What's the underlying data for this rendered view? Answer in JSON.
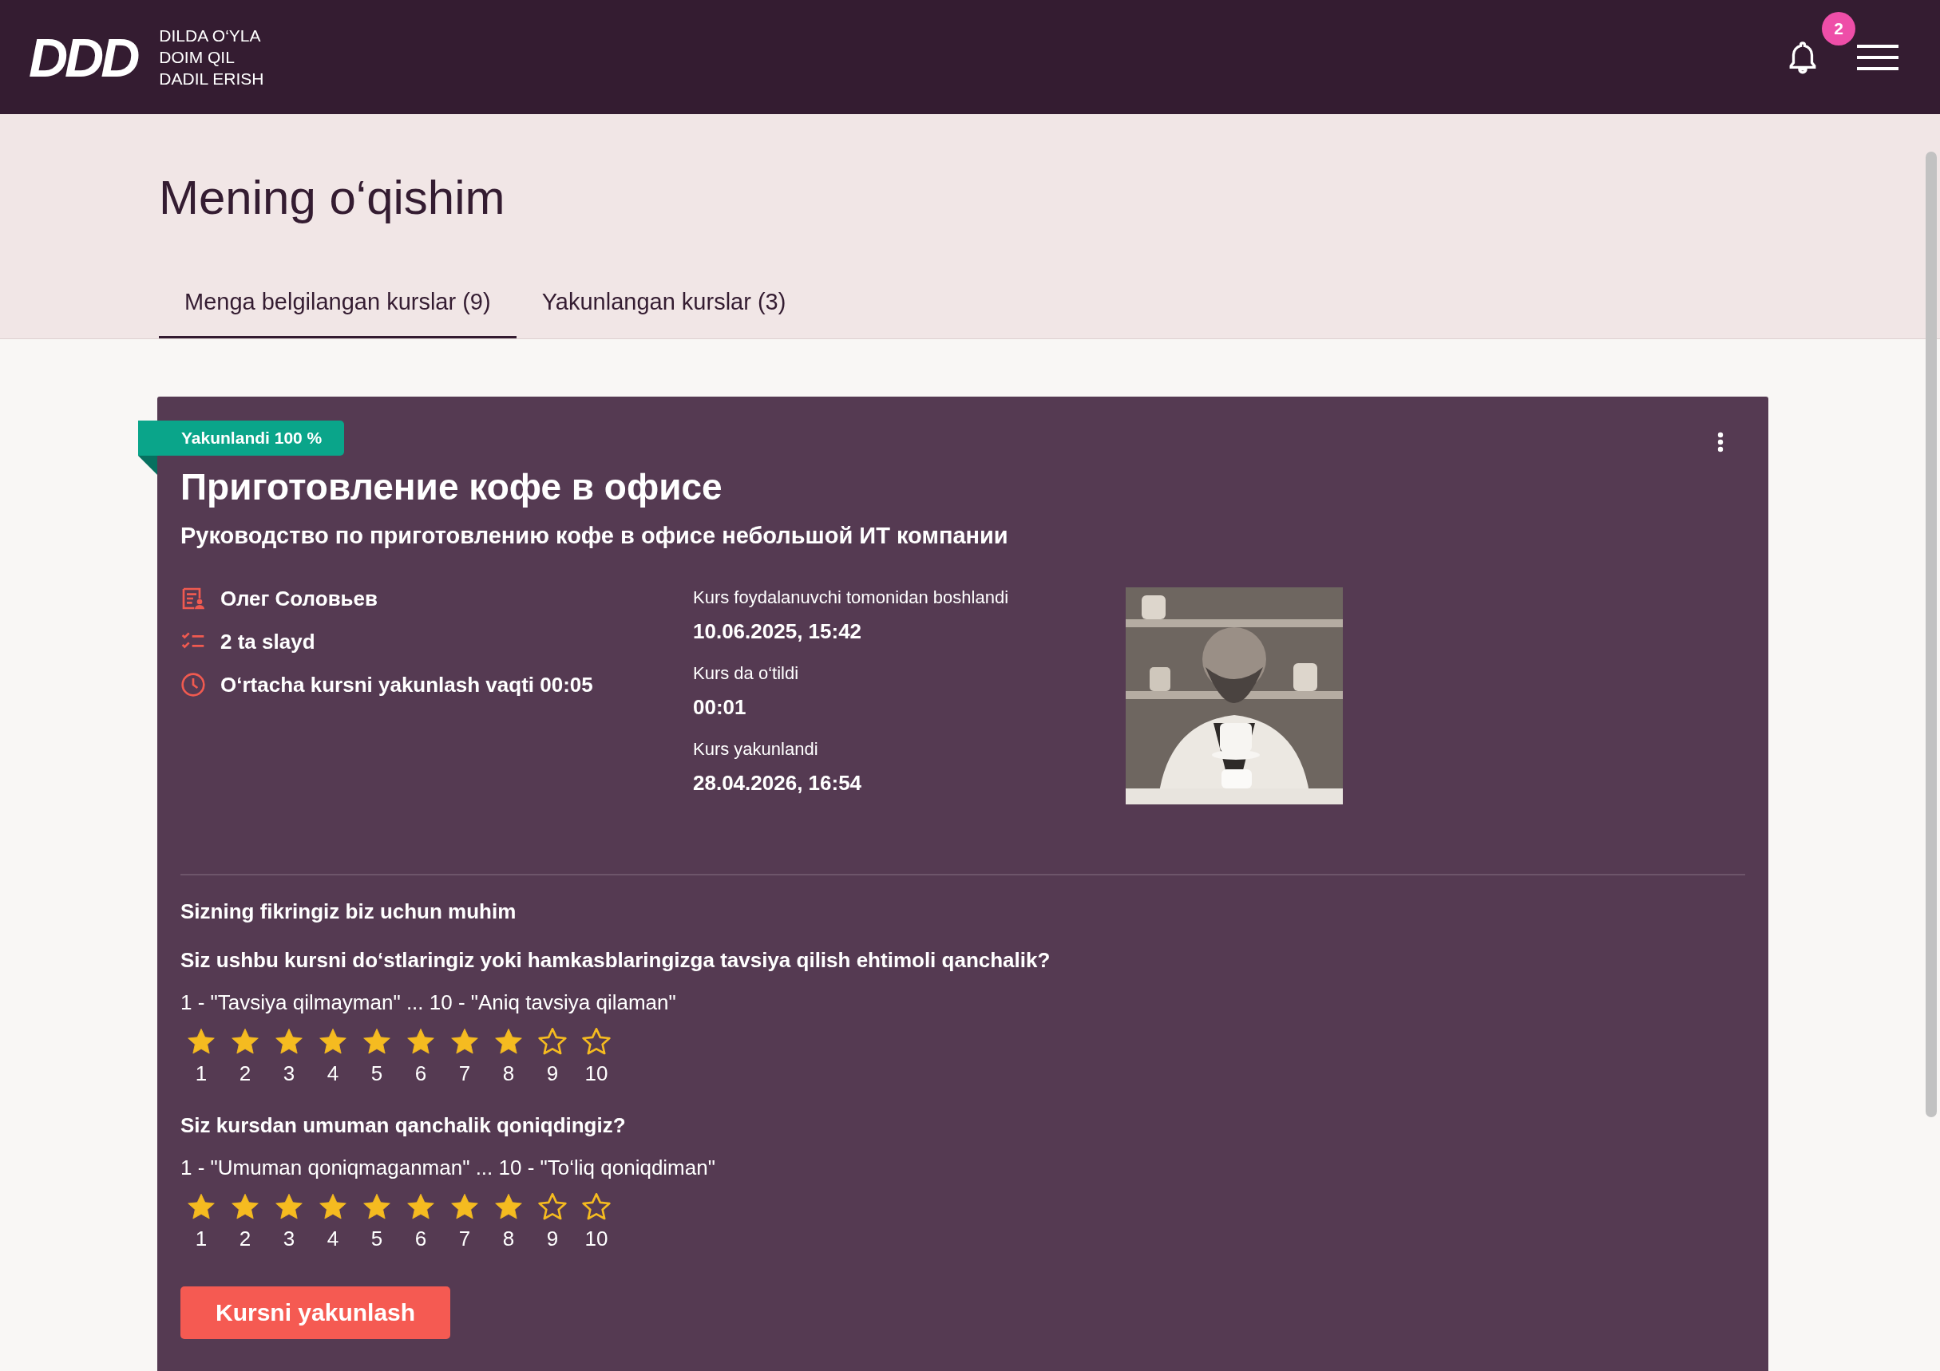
{
  "header": {
    "logo": "DDD",
    "slogan": [
      "DILDA O‘YLA",
      "DOIM QIL",
      "DADIL ERISH"
    ],
    "notification_count": "2"
  },
  "page_title": "Mening o‘qishim",
  "tabs": [
    {
      "label": "Menga belgilangan kurslar (9)",
      "selected": true
    },
    {
      "label": "Yakunlangan kurslar (3)",
      "selected": false
    }
  ],
  "course": {
    "badge": "Yakunlandi 100 %",
    "title": "Приготовление кофе в офисе",
    "subtitle": "Руководство по приготовлению кофе в офисе небольшой ИТ компании",
    "facts": [
      {
        "kind": "author",
        "text": "Олег Соловьев"
      },
      {
        "kind": "slides",
        "text": "2 ta slayd"
      },
      {
        "kind": "time",
        "text": "O‘rtacha kursni yakunlash vaqti 00:05"
      }
    ],
    "dates": [
      {
        "label": "Kurs foydalanuvchi tomonidan boshlandi",
        "value": "10.06.2025, 15:42"
      },
      {
        "label": "Kurs da o‘tildi",
        "value": "00:01"
      },
      {
        "label": "Kurs yakunlandi",
        "value": "28.04.2026, 16:54"
      }
    ],
    "feedback_title": "Sizning fikringiz biz uchun muhim",
    "questions": [
      {
        "question": "Siz ushbu kursni do‘stlaringiz yoki hamkasblaringizga tavsiya qilish ehtimoli qanchalik?",
        "scale_hint": "1 - \"Tavsiya qilmayman\" ... 10 - \"Aniq tavsiya qilaman\"",
        "stars": 8,
        "scale": [
          "1",
          "2",
          "3",
          "4",
          "5",
          "6",
          "7",
          "8",
          "9",
          "10"
        ]
      },
      {
        "question": "Siz kursdan umuman qanchalik qoniqdingiz?",
        "scale_hint": "1 - \"Umuman qoniqmaganman\" ... 10 - \"To‘liq qoniqdiman\"",
        "stars": 8,
        "scale": [
          "1",
          "2",
          "3",
          "4",
          "5",
          "6",
          "7",
          "8",
          "9",
          "10"
        ]
      }
    ],
    "finish_button": "Kursni yakunlash"
  }
}
